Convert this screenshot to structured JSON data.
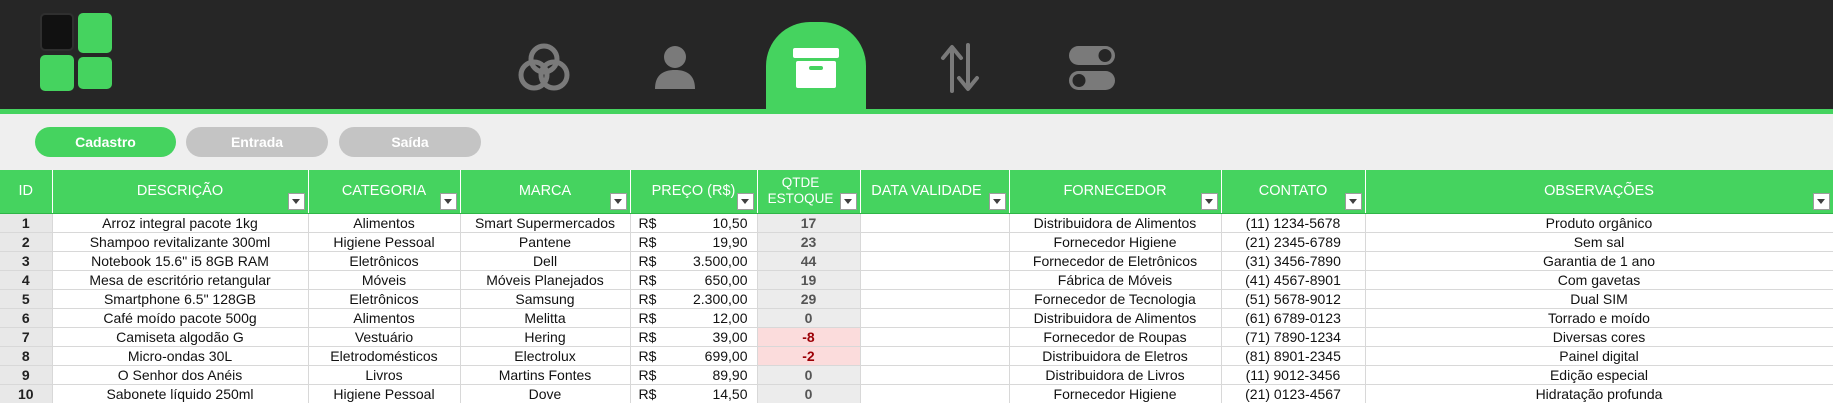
{
  "nav": {
    "items": [
      {
        "icon": "circles-venn-icon",
        "active": false
      },
      {
        "icon": "user-icon",
        "active": false
      },
      {
        "icon": "archive-box-icon",
        "active": true
      },
      {
        "icon": "up-down-arrows-icon",
        "active": false
      },
      {
        "icon": "toggles-icon",
        "active": false
      }
    ]
  },
  "tabs": [
    {
      "label": "Cadastro",
      "active": true
    },
    {
      "label": "Entrada",
      "active": false
    },
    {
      "label": "Saída",
      "active": false
    }
  ],
  "table": {
    "headers": {
      "id": "ID",
      "descricao": "DESCRIÇÃO",
      "categoria": "CATEGORIA",
      "marca": "MARCA",
      "preco": "PREÇO (R$)",
      "qtde": "QTDE ESTOQUE",
      "validade": "DATA VALIDADE",
      "fornecedor": "FORNECEDOR",
      "contato": "CONTATO",
      "obs": "OBSERVAÇÕES"
    },
    "currency": "R$",
    "rows": [
      {
        "id": "1",
        "descricao": "Arroz integral pacote 1kg",
        "categoria": "Alimentos",
        "marca": "Smart Supermercados",
        "preco": "10,50",
        "qtde": "17",
        "validade": "",
        "fornecedor": "Distribuidora de Alimentos",
        "contato": "(11) 1234-5678",
        "obs": "Produto orgânico"
      },
      {
        "id": "2",
        "descricao": "Shampoo revitalizante 300ml",
        "categoria": "Higiene Pessoal",
        "marca": "Pantene",
        "preco": "19,90",
        "qtde": "23",
        "validade": "",
        "fornecedor": "Fornecedor Higiene",
        "contato": "(21) 2345-6789",
        "obs": "Sem sal"
      },
      {
        "id": "3",
        "descricao": "Notebook 15.6\" i5 8GB RAM",
        "categoria": "Eletrônicos",
        "marca": "Dell",
        "preco": "3.500,00",
        "qtde": "44",
        "validade": "",
        "fornecedor": "Fornecedor de Eletrônicos",
        "contato": "(31) 3456-7890",
        "obs": "Garantia de 1 ano"
      },
      {
        "id": "4",
        "descricao": "Mesa de escritório retangular",
        "categoria": "Móveis",
        "marca": "Móveis Planejados",
        "preco": "650,00",
        "qtde": "19",
        "validade": "",
        "fornecedor": "Fábrica de Móveis",
        "contato": "(41) 4567-8901",
        "obs": "Com gavetas"
      },
      {
        "id": "5",
        "descricao": "Smartphone 6.5\" 128GB",
        "categoria": "Eletrônicos",
        "marca": "Samsung",
        "preco": "2.300,00",
        "qtde": "29",
        "validade": "",
        "fornecedor": "Fornecedor de Tecnologia",
        "contato": "(51) 5678-9012",
        "obs": "Dual SIM"
      },
      {
        "id": "6",
        "descricao": "Café moído pacote 500g",
        "categoria": "Alimentos",
        "marca": "Melitta",
        "preco": "12,00",
        "qtde": "0",
        "validade": "",
        "fornecedor": "Distribuidora de Alimentos",
        "contato": "(61) 6789-0123",
        "obs": "Torrado e moído"
      },
      {
        "id": "7",
        "descricao": "Camiseta algodão G",
        "categoria": "Vestuário",
        "marca": "Hering",
        "preco": "39,00",
        "qtde": "-8",
        "validade": "",
        "fornecedor": "Fornecedor de Roupas",
        "contato": "(71) 7890-1234",
        "obs": "Diversas cores"
      },
      {
        "id": "8",
        "descricao": "Micro-ondas 30L",
        "categoria": "Eletrodomésticos",
        "marca": "Electrolux",
        "preco": "699,00",
        "qtde": "-2",
        "validade": "",
        "fornecedor": "Distribuidora de Eletros",
        "contato": "(81) 8901-2345",
        "obs": "Painel digital"
      },
      {
        "id": "9",
        "descricao": "O Senhor dos Anéis",
        "categoria": "Livros",
        "marca": "Martins Fontes",
        "preco": "89,90",
        "qtde": "0",
        "validade": "",
        "fornecedor": "Distribuidora de Livros",
        "contato": "(11) 9012-3456",
        "obs": "Edição especial"
      },
      {
        "id": "10",
        "descricao": "Sabonete líquido 250ml",
        "categoria": "Higiene Pessoal",
        "marca": "Dove",
        "preco": "14,50",
        "qtde": "0",
        "validade": "",
        "fornecedor": "Fornecedor Higiene",
        "contato": "(21) 0123-4567",
        "obs": "Hidratação profunda"
      }
    ]
  },
  "colors": {
    "accent": "#45d35f",
    "topbar": "#262626",
    "icon_gray": "#7a7a7a",
    "negative_bg": "#fbdcdc",
    "negative_text": "#9c0006"
  }
}
